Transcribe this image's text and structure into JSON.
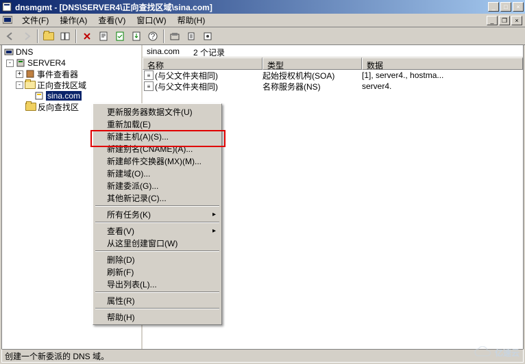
{
  "title": "dnsmgmt - [DNS\\SERVER4\\正向查找区域\\sina.com]",
  "menubar": {
    "file": "文件(F)",
    "action": "操作(A)",
    "view": "查看(V)",
    "window": "窗口(W)",
    "help": "帮助(H)"
  },
  "tree": {
    "root": "DNS",
    "server": "SERVER4",
    "eventviewer": "事件查看器",
    "forward": "正向查找区域",
    "selected": "sina.com",
    "reverse_partial": "反向查找区"
  },
  "list": {
    "summary_zone": "sina.com",
    "summary_count": "2 个记录",
    "cols": {
      "name": "名称",
      "type": "类型",
      "data": "数据"
    },
    "rows": [
      {
        "name": "(与父文件夹相同)",
        "type": "起始授权机构(SOA)",
        "data": "[1], server4., hostma..."
      },
      {
        "name": "(与父文件夹相同)",
        "type": "名称服务器(NS)",
        "data": "server4."
      }
    ]
  },
  "contextmenu": {
    "update": "更新服务器数据文件(U)",
    "reload": "重新加载(E)",
    "newhost": "新建主机(A)(S)...",
    "newalias": "新建别名(CNAME)(A)...",
    "newmx": "新建邮件交换器(MX)(M)...",
    "newdomain": "新建域(O)...",
    "newdelegation": "新建委派(G)...",
    "otherrecords": "其他新记录(C)...",
    "alltasks": "所有任务(K)",
    "view": "查看(V)",
    "newwindow": "从这里创建窗口(W)",
    "delete": "删除(D)",
    "refresh": "刷新(F)",
    "exportlist": "导出列表(L)...",
    "properties": "属性(R)",
    "help": "帮助(H)"
  },
  "statusbar": "创建一个新委派的 DNS 域。",
  "watermark": "亿速云"
}
